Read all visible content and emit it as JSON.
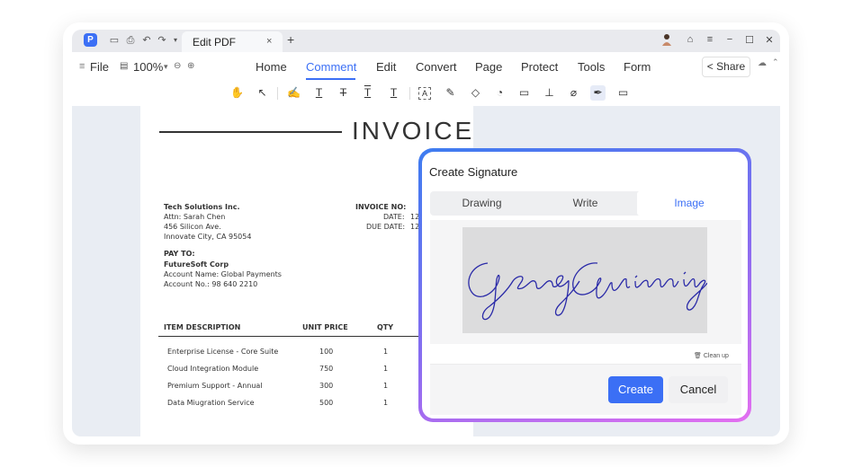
{
  "tabbar": {
    "app_logo": "P",
    "doc_tab_title": "Edit PDF",
    "close": "×",
    "new_tab": "+",
    "icons": [
      "save-icon",
      "print-icon",
      "undo-icon",
      "redo-icon",
      "dropdown-icon"
    ],
    "window_controls": [
      "−",
      "☐",
      "✕"
    ]
  },
  "menubar": {
    "file": "File",
    "zoom": "100%",
    "items": [
      "Home",
      "Comment",
      "Edit",
      "Convert",
      "Page",
      "Protect",
      "Tools",
      "Form"
    ],
    "active": "Comment",
    "share": "Share"
  },
  "invoice": {
    "title": "INVOICE",
    "from": [
      "Tech Solutions Inc.",
      "Attn: Sarah Chen",
      "456 Silicon Ave.",
      "Innovate City, CA 95054"
    ],
    "invoice_no_label": "INVOICE NO:",
    "date_label": "DATE:",
    "due_date_label": "DUE DATE:",
    "date_value": "12",
    "due_date_value": "12",
    "pay_to_label": "PAY TO:",
    "pay_to": [
      "FutureSoft Corp",
      "Account Name: Global Payments",
      "Account No.: 98 640 2210"
    ],
    "headers": [
      "ITEM DESCRIPTION",
      "UNIT PRICE",
      "QTY"
    ],
    "rows": [
      {
        "desc": "Enterprise License - Core Suite",
        "price": "100",
        "qty": "1"
      },
      {
        "desc": "Cloud Integration Module",
        "price": "750",
        "qty": "1"
      },
      {
        "desc": "Premium Support - Annual",
        "price": "300",
        "qty": "1"
      },
      {
        "desc": "Data Miugration Service",
        "price": "500",
        "qty": "1"
      }
    ]
  },
  "dialog": {
    "title": "Create Signature",
    "tabs": [
      "Drawing",
      "Write",
      "Image"
    ],
    "active_tab": "Image",
    "signature_text": "Geng Guiming",
    "cleanup": "Clean up",
    "create": "Create",
    "cancel": "Cancel"
  },
  "colors": {
    "accent": "#3b6ff5",
    "signature_ink": "#2a2aa8"
  }
}
